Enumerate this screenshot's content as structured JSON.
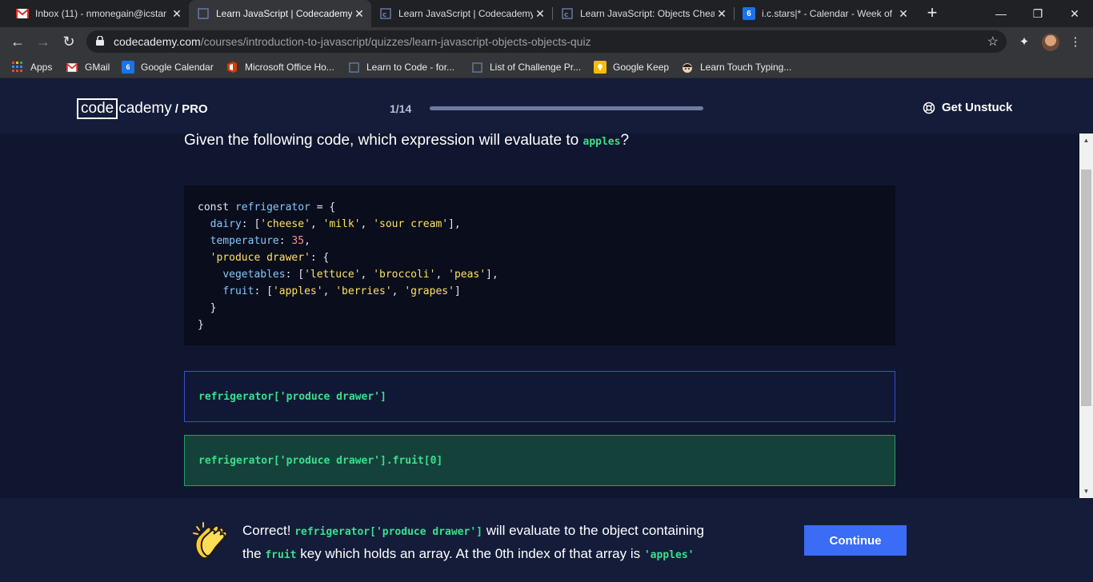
{
  "browser": {
    "tabs": [
      {
        "title": "Inbox (11) - nmonegain@icstar",
        "icon": "gmail-icon",
        "active": false
      },
      {
        "title": "Learn JavaScript | Codecademy",
        "icon": "codecademy-icon",
        "active": true
      },
      {
        "title": "Learn JavaScript | Codecademy",
        "icon": "codecademy-icon",
        "active": false
      },
      {
        "title": "Learn JavaScript: Objects Cheat",
        "icon": "codecademy-icon",
        "active": false
      },
      {
        "title": "i.c.stars|* - Calendar - Week of",
        "icon": "calendar-icon",
        "active": false
      }
    ],
    "url_host": "codecademy.com",
    "url_path": "/courses/introduction-to-javascript/quizzes/learn-javascript-objects-objects-quiz",
    "bookmarks": [
      {
        "label": "Apps",
        "icon": "apps-grid-icon"
      },
      {
        "label": "GMail",
        "icon": "gmail-icon"
      },
      {
        "label": "Google Calendar",
        "icon": "calendar-icon"
      },
      {
        "label": "Microsoft Office Ho...",
        "icon": "office-icon"
      },
      {
        "label": "Learn to Code - for...",
        "icon": "codecademy-icon"
      },
      {
        "label": "List of Challenge Pr...",
        "icon": "page-icon"
      },
      {
        "label": "Google Keep",
        "icon": "keep-icon"
      },
      {
        "label": "Learn Touch Typing...",
        "icon": "typing-icon"
      }
    ]
  },
  "header": {
    "logo_box": "code",
    "logo_rest": "cademy",
    "logo_pro": "/ PRO",
    "progress_label": "1/14",
    "progress_fraction": 1.0,
    "get_unstuck": "Get Unstuck"
  },
  "quiz": {
    "question_prefix": "Given the following code, which expression will evaluate to ",
    "question_code": "apples",
    "question_suffix": "?",
    "code_lines": [
      [
        [
          "kw",
          "const "
        ],
        [
          "key",
          "refrigerator"
        ],
        [
          "pun",
          " = {"
        ]
      ],
      [
        [
          "pun",
          "  "
        ],
        [
          "key",
          "dairy"
        ],
        [
          "pun",
          ": ["
        ],
        [
          "str",
          "'cheese'"
        ],
        [
          "pun",
          ", "
        ],
        [
          "str",
          "'milk'"
        ],
        [
          "pun",
          ", "
        ],
        [
          "str",
          "'sour cream'"
        ],
        [
          "pun",
          "],"
        ]
      ],
      [
        [
          "pun",
          "  "
        ],
        [
          "key",
          "temperature"
        ],
        [
          "pun",
          ": "
        ],
        [
          "num",
          "35"
        ],
        [
          "pun",
          ","
        ]
      ],
      [
        [
          "pun",
          "  "
        ],
        [
          "str",
          "'produce drawer'"
        ],
        [
          "pun",
          ": {"
        ]
      ],
      [
        [
          "pun",
          "    "
        ],
        [
          "key",
          "vegetables"
        ],
        [
          "pun",
          ": ["
        ],
        [
          "str",
          "'lettuce'"
        ],
        [
          "pun",
          ", "
        ],
        [
          "str",
          "'broccoli'"
        ],
        [
          "pun",
          ", "
        ],
        [
          "str",
          "'peas'"
        ],
        [
          "pun",
          "],"
        ]
      ],
      [
        [
          "pun",
          "    "
        ],
        [
          "key",
          "fruit"
        ],
        [
          "pun",
          ": ["
        ],
        [
          "str",
          "'apples'"
        ],
        [
          "pun",
          ", "
        ],
        [
          "str",
          "'berries'"
        ],
        [
          "pun",
          ", "
        ],
        [
          "str",
          "'grapes'"
        ],
        [
          "pun",
          "]"
        ]
      ],
      [
        [
          "pun",
          "  }"
        ]
      ],
      [
        [
          "pun",
          "}"
        ]
      ]
    ],
    "options": [
      "refrigerator['produce drawer']",
      "refrigerator['produce drawer'].fruit[0]"
    ]
  },
  "feedback": {
    "correct": "Correct!",
    "code1": "refrigerator['produce drawer']",
    "text1": " will evaluate to the object containing",
    "text2a": "the ",
    "code2": "fruit",
    "text2b": " key which holds an array. At the 0th index of that array is ",
    "code3": "'apples'",
    "continue_label": "Continue"
  },
  "colors": {
    "page_bg": "#10162f",
    "header_bg": "#141c3a",
    "code_green": "#3be08a",
    "button_blue": "#3a6cf5",
    "selected_correct_bg": "#15413b"
  }
}
